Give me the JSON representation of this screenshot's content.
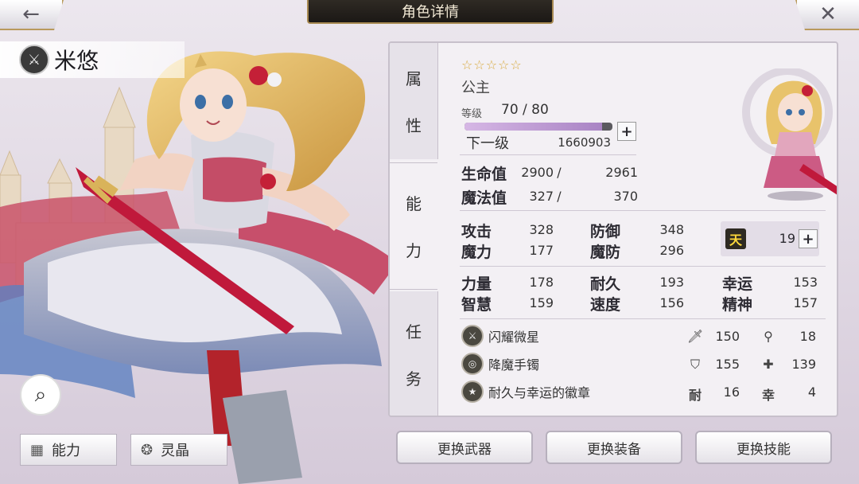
{
  "header": {
    "title": "角色详情",
    "back_icon": "←",
    "close_icon": "✕"
  },
  "character": {
    "name": "米悠",
    "class_icon": "sword-icon"
  },
  "left_tabs": {
    "ability": "能力",
    "crystal": "灵晶"
  },
  "side_tabs": {
    "attributes": [
      "属",
      "性"
    ],
    "ability": [
      "能",
      "力"
    ],
    "quest": [
      "任",
      "务"
    ]
  },
  "attributes": {
    "stars": "☆☆☆☆☆",
    "title": "公主",
    "level_label": "等级",
    "level_value": "70 / 80",
    "xp_progress": 0.93,
    "next_label": "下一级",
    "next_value": "1660903"
  },
  "vitals": {
    "hp_label": "生命值",
    "hp_cur": "2900",
    "hp_sep": "/",
    "hp_max": "2961",
    "mp_label": "魔法值",
    "mp_cur": "327",
    "mp_sep": "/",
    "mp_max": "370"
  },
  "combat": {
    "atk_label": "攻击",
    "atk": "328",
    "def_label": "防御",
    "def": "348",
    "mag_label": "魔力",
    "mag": "177",
    "mdef_label": "魔防",
    "mdef": "296",
    "ten_icon": "天",
    "ten_value": "19"
  },
  "base_stats": {
    "str_label": "力量",
    "str": "178",
    "end_label": "耐久",
    "end": "193",
    "luck_label": "幸运",
    "luck": "153",
    "int_label": "智慧",
    "int": "159",
    "spd_label": "速度",
    "spd": "156",
    "spi_label": "精神",
    "spi": "157"
  },
  "equipment": [
    {
      "name": "闪耀微星",
      "icon": "sword-icon",
      "s1_icon": "🗡",
      "s1": "150",
      "s2_icon": "⚲",
      "s2": "18"
    },
    {
      "name": "降魔手镯",
      "icon": "bracelet-icon",
      "s1_icon": "⛉",
      "s1": "155",
      "s2_icon": "✚",
      "s2": "139"
    },
    {
      "name": "耐久与幸运的徽章",
      "icon": "badge-icon",
      "s1_icon": "耐",
      "s1": "16",
      "s2_icon": "幸",
      "s2": "4"
    }
  ],
  "buttons": {
    "change_weapon": "更换武器",
    "change_equip": "更换装备",
    "change_skill": "更换技能"
  }
}
